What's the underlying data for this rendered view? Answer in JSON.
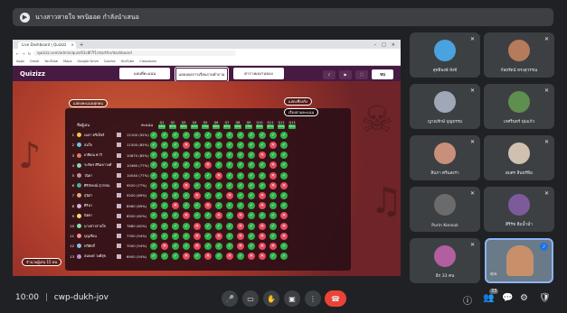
{
  "meeting": {
    "presenter_banner": "นางสาวสายใจ พรนิยอด กำลังนำเสนอ",
    "time": "10:00",
    "separator": "|",
    "code": "cwp-dukh-jov",
    "participant_badge": "33",
    "self_name": "คุณ"
  },
  "browser": {
    "tab_title": "Live Dashboard | Quizizz",
    "tab_close": "×",
    "new_tab": "+",
    "win_min": "–",
    "win_max": "□",
    "win_close": "×",
    "nav_back": "←",
    "nav_fwd": "→",
    "reload": "↻",
    "url": "quizizz.com/admin/quiz/63c8f7f1/startfor/dashboard",
    "bookmarks": [
      "Apps",
      "Gmail",
      "YouTube",
      "Maps",
      "Google Drive",
      "Quizizz",
      "YouTube",
      "Classroom"
    ]
  },
  "quiz": {
    "logo": "Quizizz",
    "tabs": [
      "แผนที่คะแนน",
      "แสดงผลการเรียนรายคำถาม",
      "ตารางผลงานของ"
    ],
    "tools": [
      "♪",
      "▶",
      "⛶"
    ],
    "end_label": "จบ",
    "left_pill": "แสดงคะแนนทุกคน",
    "right_pill1": "แสดงชื่อจริง",
    "right_pill2": "เรียงตามคะแนน",
    "bottom_pill": "จำนวนผู้เล่น 15 คน",
    "col_name": "ชื่อผู้เล่น",
    "col_score": "คะแนน",
    "questions": [
      {
        "q": "Q1",
        "pct": "93%"
      },
      {
        "q": "Q2",
        "pct": "87%"
      },
      {
        "q": "Q3",
        "pct": "80%"
      },
      {
        "q": "Q4",
        "pct": "67%"
      },
      {
        "q": "Q5",
        "pct": "73%"
      },
      {
        "q": "Q6",
        "pct": "80%"
      },
      {
        "q": "Q7",
        "pct": "87%"
      },
      {
        "q": "Q8",
        "pct": "60%"
      },
      {
        "q": "Q9",
        "pct": "73%"
      },
      {
        "q": "Q10",
        "pct": "80%"
      },
      {
        "q": "Q11",
        "pct": "67%"
      },
      {
        "q": "Q12",
        "pct": "53%"
      },
      {
        "q": "Q13",
        "pct": "60%"
      }
    ],
    "players": [
      {
        "n": "1",
        "name": "เฉลา ตรีเพ็ชร์",
        "score": "12100 (92%)",
        "pat": "ccccccccccccc"
      },
      {
        "n": "2",
        "name": "สมใจ",
        "score": "11500 (85%)",
        "pat": "cccwcccccccwc"
      },
      {
        "n": "3",
        "name": "เกษียณ คาวี",
        "score": "10870 (85%)",
        "pat": "ccccccccccwcc"
      },
      {
        "n": "4",
        "name": "ระพีพร ศิริมหาวงศ์",
        "score": "10460 (77%)",
        "pat": "cccccwcccccwc"
      },
      {
        "n": "5",
        "name": "วนิดา",
        "score": "10040 (77%)",
        "pat": "ccccccwccccwc"
      },
      {
        "n": "6",
        "name": "ศิริลักษณ์ สุวรรณ",
        "score": "9520 (77%)",
        "pat": "cccwcccccccww"
      },
      {
        "n": "7",
        "name": "สุนิสา",
        "score": "9200 (69%)",
        "pat": "ccccwccwccwcc"
      },
      {
        "n": "8",
        "name": "ศิรินา",
        "score": "8960 (69%)",
        "pat": "ccwccwccccwcc"
      },
      {
        "n": "9",
        "name": "นิตยา",
        "score": "8500 (62%)",
        "pat": "cccwccwcwcccw"
      },
      {
        "n": "10",
        "name": "นางสาวสายใจ",
        "score": "7880 (62%)",
        "pat": "ccccwcccwcwcw"
      },
      {
        "n": "11",
        "name": "บุญเรือน",
        "score": "7350 (54%)",
        "pat": "ccccwcwcwcwcw"
      },
      {
        "n": "12",
        "name": "ทวีศักดิ์",
        "score": "7000 (54%)",
        "pat": "cwccwcccwcwwc"
      },
      {
        "n": "13",
        "name": "สมพงษ์ วงศ์สุข",
        "score": "6900 (54%)",
        "pat": "cccwcwcwcwwcc"
      }
    ]
  },
  "participants": [
    {
      "name": "สุทธิพงษ์ สังข์",
      "color": "#4aa3df"
    },
    {
      "name": "กัลยรัตน์ ทรงสุวรรณ",
      "color": "#b67b5b"
    },
    {
      "name": "ญาณรักษ์ บุญธรรม",
      "color": "#a0a8b8"
    },
    {
      "name": "เกศรินทร์ พุ่มแก้ว",
      "color": "#5e8f4e"
    },
    {
      "name": "สิปภา ศรีแสงร่า",
      "color": "#c8907a"
    },
    {
      "name": "สมศร สินทร์ทิม",
      "color": "#d0c0b0"
    },
    {
      "name": "Purin Konsuk",
      "color": "#6b6b6b"
    },
    {
      "name": "ศิริรัช ฮีมน้ำฉ่ำ",
      "color": "#7d5a9a"
    },
    {
      "name": "อีก 33 คน",
      "color": "#b25fa0"
    }
  ],
  "controls": {
    "mic": "🎤",
    "cam": "▭",
    "hand": "✋",
    "present": "▣",
    "more": "⋮",
    "end": "☎",
    "info": "ⓘ",
    "people": "👥",
    "chat": "💬",
    "activities": "⚙",
    "host": "🛡"
  },
  "colors": {
    "meet_bg": "#202124",
    "tile_bg": "#3c4043",
    "quiz_header": "#461a42",
    "correct": "#2eb34a",
    "wrong": "#e8485d",
    "end_call": "#ea4335"
  }
}
